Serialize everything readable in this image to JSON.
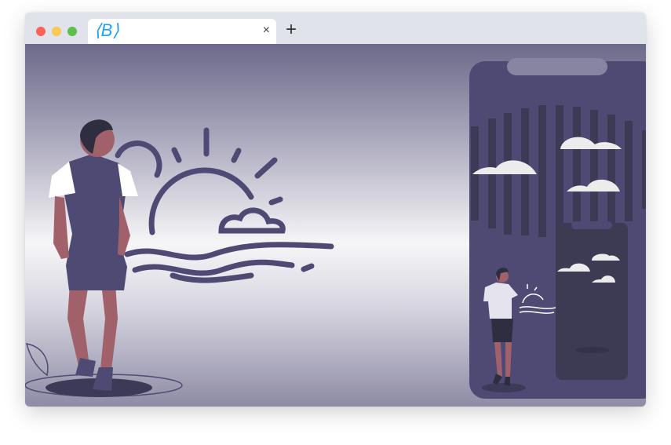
{
  "browser": {
    "tab": {
      "logo_text": "⟨B⟩",
      "close_label": "×"
    },
    "new_tab_label": "+"
  },
  "colors": {
    "accent": "#1aa3ef",
    "illustration": "#4e4a74",
    "skin": "#a0616a",
    "background_top": "#6d698a"
  }
}
